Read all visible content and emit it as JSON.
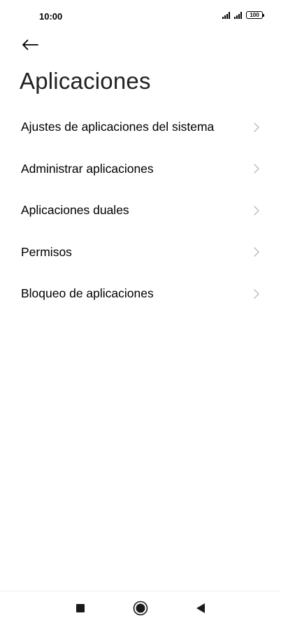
{
  "status_bar": {
    "time": "10:00",
    "battery_level": "100",
    "icons": [
      "signal-icon",
      "signal-icon",
      "battery-icon"
    ]
  },
  "header": {
    "back_icon": "arrow-left-icon",
    "title": "Aplicaciones"
  },
  "settings": {
    "items": [
      {
        "label": "Ajustes de aplicaciones del sistema",
        "icon": "chevron-right-icon"
      },
      {
        "label": "Administrar aplicaciones",
        "icon": "chevron-right-icon"
      },
      {
        "label": "Aplicaciones duales",
        "icon": "chevron-right-icon"
      },
      {
        "label": "Permisos",
        "icon": "chevron-right-icon"
      },
      {
        "label": "Bloqueo de aplicaciones",
        "icon": "chevron-right-icon"
      }
    ]
  },
  "nav_bar": {
    "buttons": [
      "recents-square-icon",
      "home-circle-icon",
      "back-triangle-icon"
    ]
  },
  "colors": {
    "background": "#ffffff",
    "text_primary": "#000000",
    "title": "#222222",
    "chevron": "#b8b8b8",
    "nav_icons": "#1a1a1a"
  }
}
